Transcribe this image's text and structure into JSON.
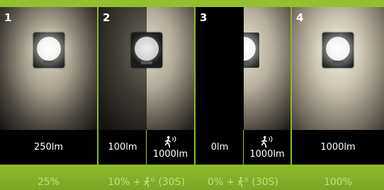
{
  "panels": [
    {
      "number": "1",
      "lumens": "250lm"
    },
    {
      "number": "2",
      "lumens_base": "100lm",
      "lumens_motion": "1000lm"
    },
    {
      "number": "3",
      "lumens_base": "0lm",
      "lumens_motion": "1000lm"
    },
    {
      "number": "4",
      "lumens": "1000lm"
    }
  ],
  "modes": [
    {
      "prefix": "25%",
      "suffix": ""
    },
    {
      "prefix": "10% +",
      "suffix": "(30S)"
    },
    {
      "prefix": "0% +",
      "suffix": "(30S)"
    },
    {
      "prefix": "100%",
      "suffix": ""
    }
  ],
  "icons": [
    "motion-sensor-icon",
    "wall-lamp-icon"
  ],
  "colors": {
    "background_green": "#8bb82a",
    "text_faded": "#c7dd88"
  }
}
